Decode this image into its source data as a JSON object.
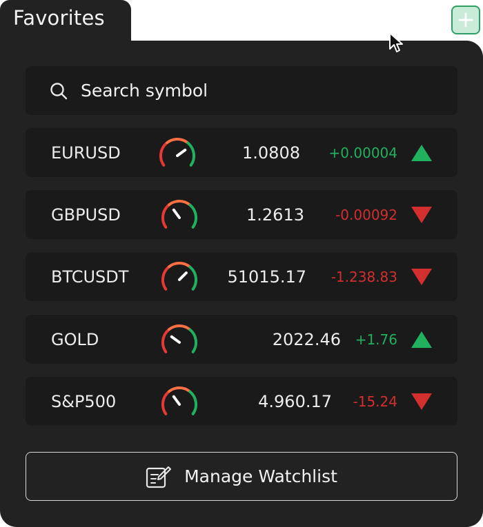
{
  "favorites_tab": {
    "label": "Favorites"
  },
  "search": {
    "placeholder": "Search symbol"
  },
  "colors": {
    "up": "#21b05e",
    "down": "#d32f2f",
    "panel": "#222222",
    "row": "#1a1a1a"
  },
  "watchlist": [
    {
      "symbol": "EURUSD",
      "price": "1.0808",
      "change": "+0.00004",
      "direction": "up",
      "sentiment": 0.8
    },
    {
      "symbol": "GBPUSD",
      "price": "1.2613",
      "change": "-0.00092",
      "direction": "down",
      "sentiment": 0.3
    },
    {
      "symbol": "BTCUSDT",
      "price": "51015.17",
      "change": "-1.238.83",
      "direction": "down",
      "sentiment": 0.75
    },
    {
      "symbol": "GOLD",
      "price": "2022.46",
      "change": "+1.76",
      "direction": "up",
      "sentiment": 0.2
    },
    {
      "symbol": "S&P500",
      "price": "4.960.17",
      "change": "-15.24",
      "direction": "down",
      "sentiment": 0.3
    }
  ],
  "manage_button": {
    "label": "Manage Watchlist",
    "icon": "edit-list-icon"
  },
  "add_button": {
    "icon": "plus-icon"
  }
}
